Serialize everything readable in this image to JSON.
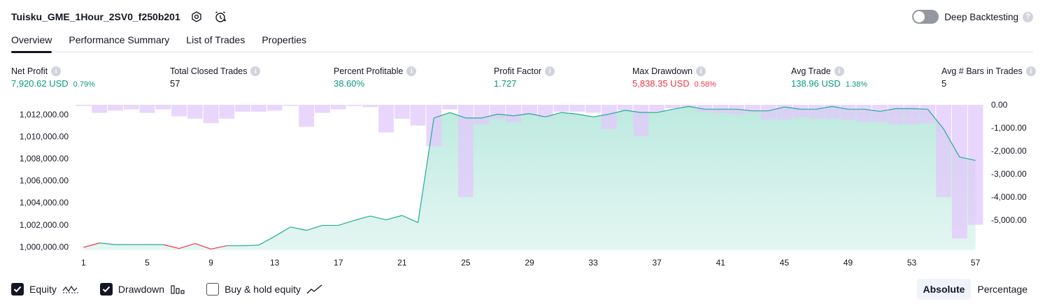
{
  "header": {
    "strategy_name": "Tuisku_GME_1Hour_2SV0_f250b201"
  },
  "deep_backtesting": {
    "label": "Deep Backtesting",
    "enabled": false,
    "help": "?"
  },
  "tabs": [
    {
      "label": "Overview",
      "active": true
    },
    {
      "label": "Performance Summary",
      "active": false
    },
    {
      "label": "List of Trades",
      "active": false
    },
    {
      "label": "Properties",
      "active": false
    }
  ],
  "metrics": [
    {
      "label": "Net Profit",
      "value": "7,920.62 USD",
      "pct": "0.79%",
      "color": "#089981"
    },
    {
      "label": "Total Closed Trades",
      "value": "57",
      "pct": "",
      "color": "#131722"
    },
    {
      "label": "Percent Profitable",
      "value": "38.60%",
      "pct": "",
      "color": "#089981"
    },
    {
      "label": "Profit Factor",
      "value": "1.727",
      "pct": "",
      "color": "#089981"
    },
    {
      "label": "Max Drawdown",
      "value": "5,838.35 USD",
      "pct": "0.58%",
      "color": "#f23645"
    },
    {
      "label": "Avg Trade",
      "value": "138.96 USD",
      "pct": "1.38%",
      "color": "#089981"
    },
    {
      "label": "Avg # Bars in Trades",
      "value": "5",
      "pct": "",
      "color": "#131722"
    }
  ],
  "legend": {
    "equity": {
      "label": "Equity",
      "checked": true
    },
    "drawdown": {
      "label": "Drawdown",
      "checked": true
    },
    "buy_hold": {
      "label": "Buy & hold equity",
      "checked": false
    }
  },
  "mode": {
    "absolute": "Absolute",
    "percentage": "Percentage",
    "selected": "Absolute"
  },
  "chart_data": {
    "type": "line",
    "x_ticks": [
      1,
      5,
      9,
      13,
      17,
      21,
      25,
      29,
      33,
      37,
      41,
      45,
      49,
      53,
      57
    ],
    "left_ticks": [
      "1,000,000.00",
      "1,002,000.00",
      "1,004,000.00",
      "1,006,000.00",
      "1,008,000.00",
      "1,010,000.00",
      "1,012,000.00"
    ],
    "left_tick_values": [
      1000000,
      1002000,
      1004000,
      1006000,
      1008000,
      1010000,
      1012000
    ],
    "right_ticks": [
      "0.00",
      "-1,000.00",
      "-2,000.00",
      "-3,000.00",
      "-4,000.00",
      "-5,000.00"
    ],
    "right_tick_values": [
      0,
      -1000,
      -2000,
      -3000,
      -4000,
      -5000
    ],
    "equity_ylim": [
      999700,
      1012900
    ],
    "drawdown_ylim": [
      -6300,
      0
    ],
    "grid": false,
    "colors": {
      "equity_line": "#22ab94",
      "equity_fill": "#b2e6da",
      "negative_line": "#f23645",
      "drawdown_bar": "#e1c8fb",
      "drawdown_overlap": "#b9b6ea"
    },
    "series": [
      {
        "name": "Equity",
        "values": [
          999950,
          1000350,
          1000200,
          1000200,
          1000200,
          1000200,
          999850,
          1000300,
          999800,
          1000100,
          1000100,
          1000150,
          1000950,
          1001800,
          1001500,
          1001950,
          1001950,
          1002400,
          1002800,
          1002450,
          1002850,
          1002200,
          1011700,
          1012200,
          1011700,
          1011700,
          1012050,
          1011900,
          1012100,
          1011800,
          1012200,
          1012050,
          1011800,
          1012050,
          1012400,
          1012200,
          1012200,
          1012500,
          1012750,
          1012500,
          1012500,
          1012500,
          1012350,
          1012350,
          1012700,
          1012500,
          1012500,
          1012750,
          1012500,
          1012500,
          1012300,
          1012550,
          1012550,
          1012500,
          1010700,
          1008150,
          1007850
        ]
      },
      {
        "name": "Drawdown",
        "values": [
          -50,
          -350,
          -250,
          -200,
          -350,
          -200,
          -500,
          -600,
          -800,
          -600,
          -300,
          -300,
          -250,
          -50,
          -950,
          -350,
          -200,
          -50,
          -100,
          -1200,
          -600,
          -900,
          -1800,
          -200,
          -4000,
          -850,
          -600,
          -750,
          -450,
          -550,
          -300,
          -300,
          -350,
          -1050,
          -250,
          -1350,
          -300,
          -150,
          -100,
          -300,
          -350,
          -400,
          -350,
          -650,
          -650,
          -550,
          -600,
          -600,
          -650,
          -750,
          -750,
          -850,
          -850,
          -800,
          -4000,
          -5800,
          -5200
        ]
      }
    ]
  }
}
